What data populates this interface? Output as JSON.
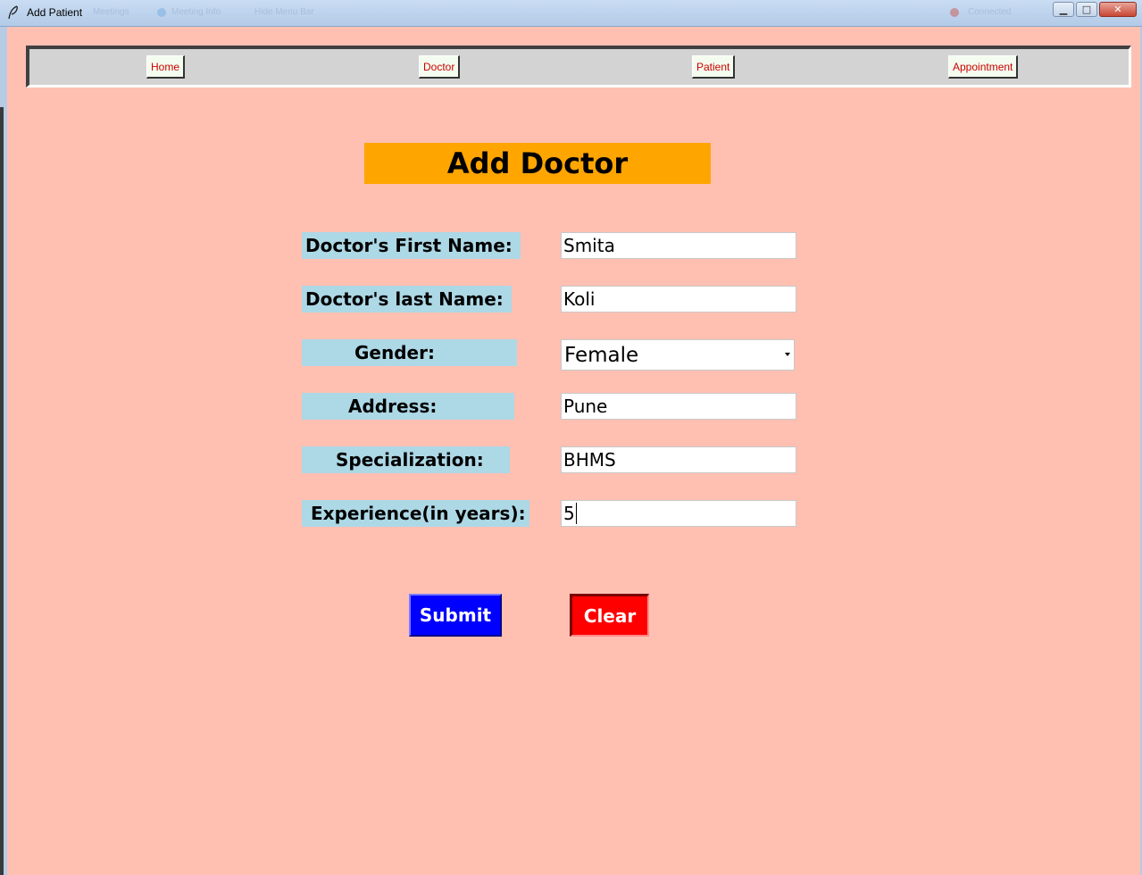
{
  "window": {
    "title": "Add Patient",
    "ghost_items": [
      "Meetings",
      "Meeting Info",
      "Hide Menu Bar",
      "Connected"
    ],
    "buttons": [
      "▁",
      "□",
      "✕"
    ]
  },
  "nav": {
    "home": "Home",
    "doctor": "Doctor",
    "patient": "Patient",
    "appointment": "Appointment"
  },
  "form": {
    "heading": "Add Doctor",
    "first_name_label": "Doctor's First Name:",
    "first_name_value": "Smita",
    "last_name_label": "Doctor's last Name:",
    "last_name_value": "Koli",
    "gender_label": "Gender:",
    "gender_value": "Female",
    "address_label": "Address:",
    "address_value": "Pune",
    "specialization_label": "Specialization:",
    "specialization_value": "BHMS",
    "experience_label": "Experience(in years):",
    "experience_value": "5"
  },
  "actions": {
    "submit": "Submit",
    "clear": "Clear"
  },
  "colors": {
    "background": "#ffc0b2",
    "heading_bg": "#ffa500",
    "label_bg": "#add8e6",
    "submit_bg": "#0000ff",
    "clear_bg": "#ff0000",
    "nav_text": "#cc0000"
  }
}
